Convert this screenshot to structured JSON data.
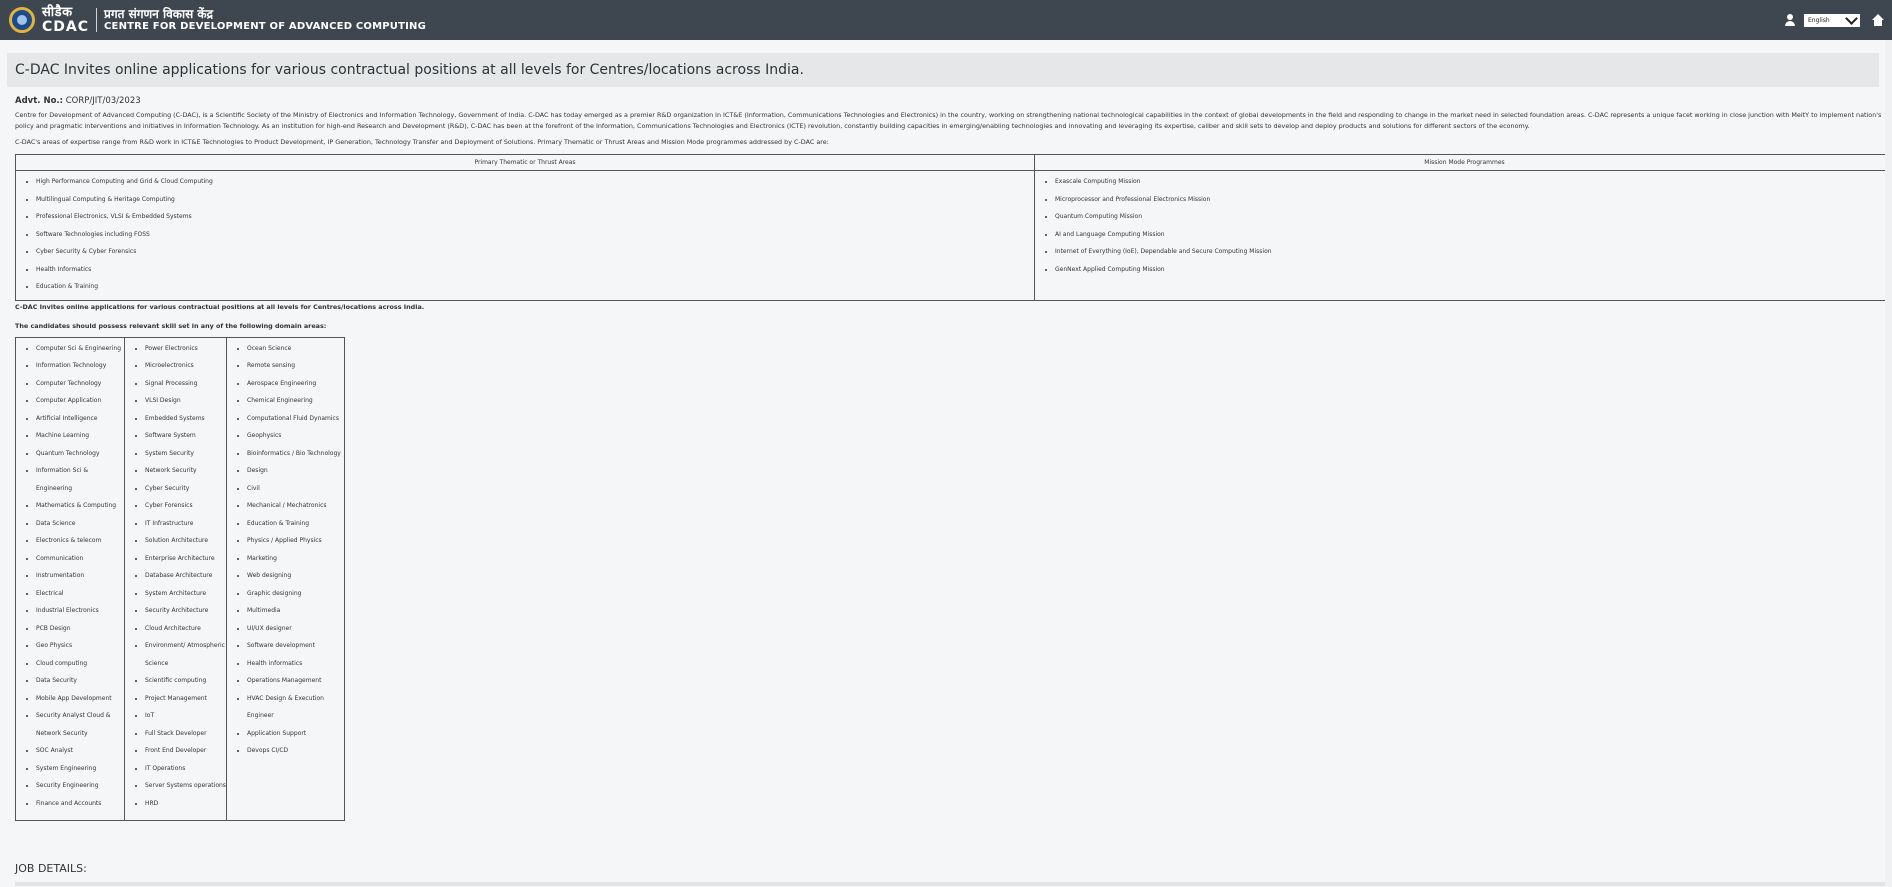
{
  "header": {
    "brand_hindi": "सीडैक",
    "brand_latin": "CDAC",
    "org_hindi": "प्रगत संगणन विकास केंद्र",
    "org_english": "CENTRE FOR DEVELOPMENT OF ADVANCED COMPUTING",
    "language": "English"
  },
  "page_title": "C-DAC Invites online applications for various contractual positions at all levels for Centres/locations across India.",
  "advt": {
    "label": "Advt. No.:",
    "value": "CORP/JIT/03/2023"
  },
  "intro": "Centre for Development of Advanced Computing (C-DAC), is a Scientific Society of the Ministry of Electronics and Information Technology, Government of India. C-DAC has today emerged as a premier R&D organization in ICT&E (Information, Communications Technologies and Electronics) in the country, working on strengthening national technological capabilities in the context of global developments in the field and responding to change in the market need in selected foundation areas. C-DAC represents a unique facet working in close junction with MeitY to implement nation's policy and pragmatic interventions and initiatives in Information Technology. As an institution for high-end Research and Development (R&D), C-DAC has been at the forefront of the Information, Communications Technologies and Electronics (ICTE) revolution, constantly building capacities in emerging/enabling technologies and innovating and leveraging its expertise, caliber and skill sets to develop and deploy products and solutions for different sectors of the economy.",
  "areas_intro": "C-DAC's areas of expertise range from R&D work in ICT&E Technologies to Product Development, IP Generation, Technology Transfer and Deployment of Solutions. Primary Thematic or Thrust Areas and Mission Mode programmes addressed by C-DAC are:",
  "areas_table": {
    "col1_header": "Primary Thematic or Thrust Areas",
    "col2_header": "Mission Mode Programmes",
    "col1": [
      "High Performance Computing and Grid & Cloud Computing",
      "Multilingual Computing & Heritage Computing",
      "Professional Electronics, VLSI & Embedded Systems",
      "Software Technologies including FOSS",
      "Cyber Security & Cyber Forensics",
      "Health Informatics",
      "Education & Training"
    ],
    "col2": [
      "Exascale Computing Mission",
      "Microprocessor and Professional Electronics Mission",
      "Quantum Computing Mission",
      "AI and Language Computing Mission",
      "Internet of Everything (IoE), Dependable and Secure Computing Mission",
      "GenNext Applied Computing Mission"
    ]
  },
  "note1": "C-DAC Invites online applications for various contractual positions at all levels for Centres/locations across India.",
  "note2": "The candidates should possess relevant skill set in any of the following domain areas:",
  "domains": {
    "col1": [
      "Computer Sci & Engineering",
      "Information Technology",
      "Computer Technology",
      "Computer Application",
      "Artificial Intelligence",
      "Machine Learning",
      "Quantum Technology",
      "Information Sci & Engineering",
      "Mathematics & Computing",
      "Data Science",
      "Electronics & telecom",
      "Communication",
      "Instrumentation",
      "Electrical",
      "Industrial Electronics",
      "PCB Design",
      "Geo Physics",
      "Cloud computing",
      "Data Security",
      "Mobile App Development",
      "Security Analyst Cloud & Network Security",
      "SOC Analyst",
      "System Engineering",
      "Security Engineering",
      "Finance and Accounts"
    ],
    "col2": [
      "Power Electronics",
      "Microelectronics",
      "Signal Processing",
      "VLSI Design",
      "Embedded Systems",
      "Software System",
      "System Security",
      "Network Security",
      "Cyber Security",
      "Cyber Forensics",
      "IT Infrastructure",
      "Solution Architecture",
      "Enterprise Architecture",
      "Database Architecture",
      "System Architecture",
      "Security Architecture",
      "Cloud Architecture",
      "Environment/ Atmospheric Science",
      "Scientific computing",
      "Project Management",
      "IoT",
      "Full Stack Developer",
      "Front End Developer",
      "IT Operations",
      "Server Systems operations",
      "HRD"
    ],
    "col3": [
      "Ocean Science",
      "Remote sensing",
      "Aerospace Engineering",
      "Chemical Engineering",
      "Computational Fluid Dynamics",
      "Geophysics",
      "Bioinformatics / Bio Technology",
      "Design",
      "Civil",
      "Mechanical / Mechatronics",
      "Education & Training",
      "Physics / Applied Physics",
      "Marketing",
      "Web designing",
      "Graphic designing",
      "Multimedia",
      "UI/UX designer",
      "Software development",
      "Health informatics",
      "Operations Management",
      "HVAC Design & Execution Engineer",
      "Application Support",
      "Devops CI/CD"
    ]
  },
  "job_details_heading": "JOB DETAILS:"
}
